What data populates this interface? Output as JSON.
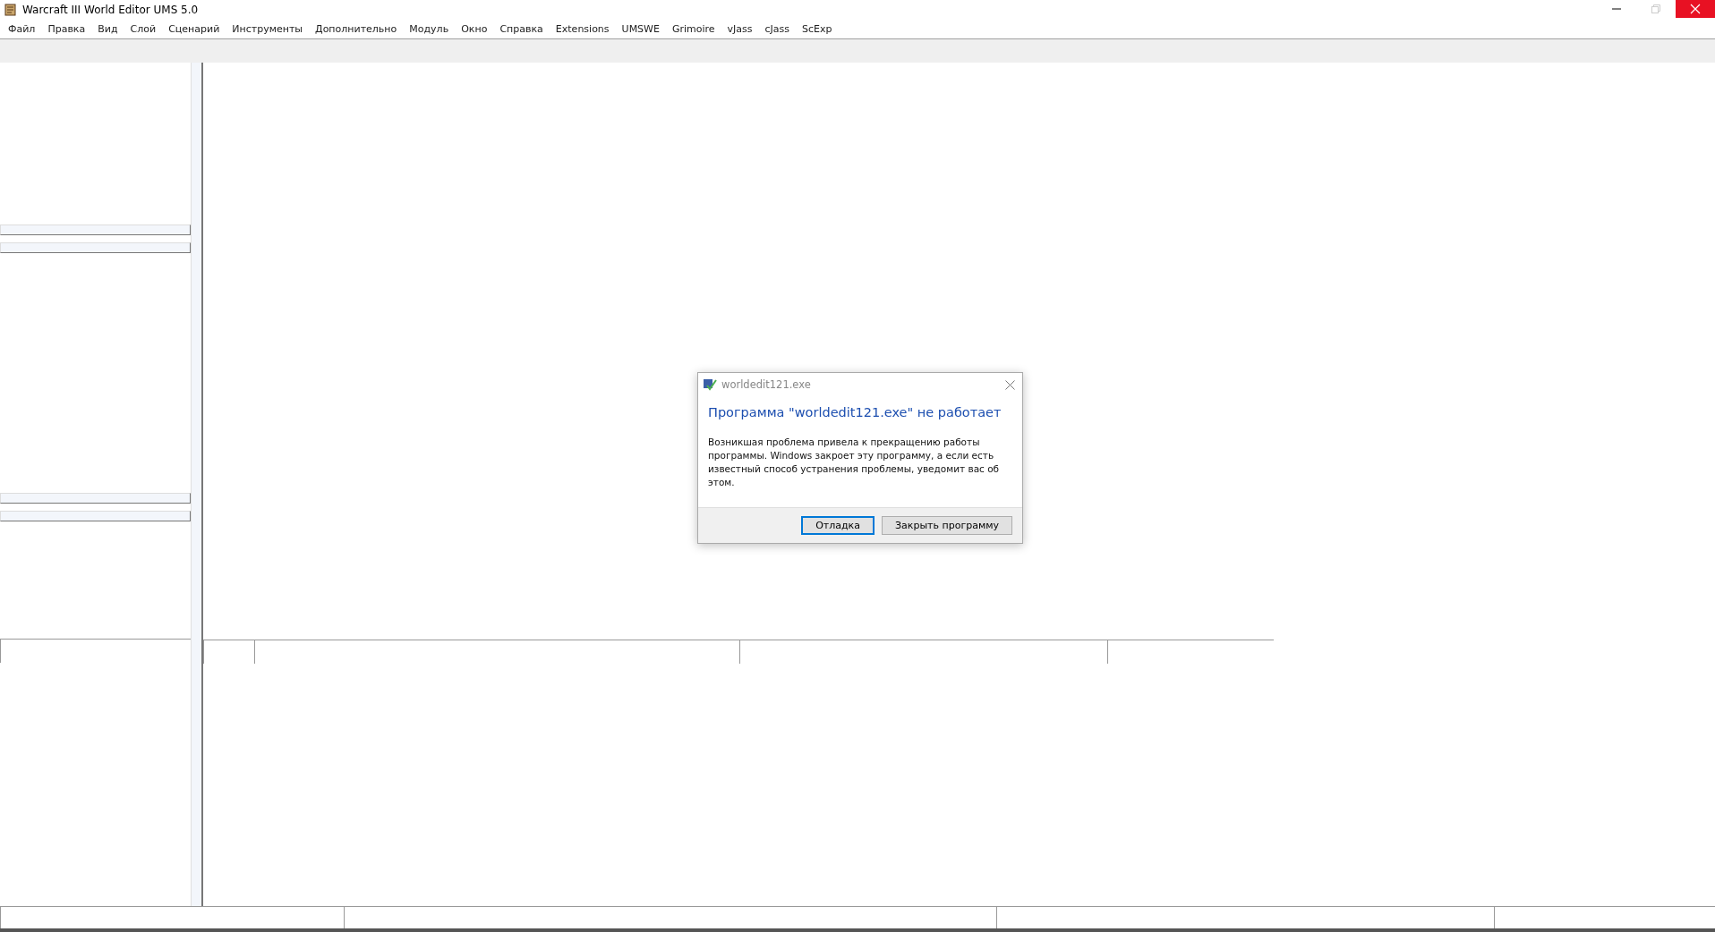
{
  "window": {
    "title": "Warcraft III World Editor UMS 5.0"
  },
  "menu": [
    "Файл",
    "Правка",
    "Вид",
    "Слой",
    "Сценарий",
    "Инструменты",
    "Дополнительно",
    "Модуль",
    "Окно",
    "Справка",
    "Extensions",
    "UMSWE",
    "Grimoire",
    "vJass",
    "cJass",
    "ScExp"
  ],
  "dialog": {
    "title": "worldedit121.exe",
    "heading": "Программа \"worldedit121.exe\" не работает",
    "message": "Возникшая проблема привела к прекращению работы программы. Windows закроет эту программу, а если есть известный способ устранения проблемы, уведомит вас об этом.",
    "buttons": [
      {
        "label": "Отладка",
        "default": true
      },
      {
        "label": "Закрыть программу",
        "default": false
      }
    ]
  }
}
